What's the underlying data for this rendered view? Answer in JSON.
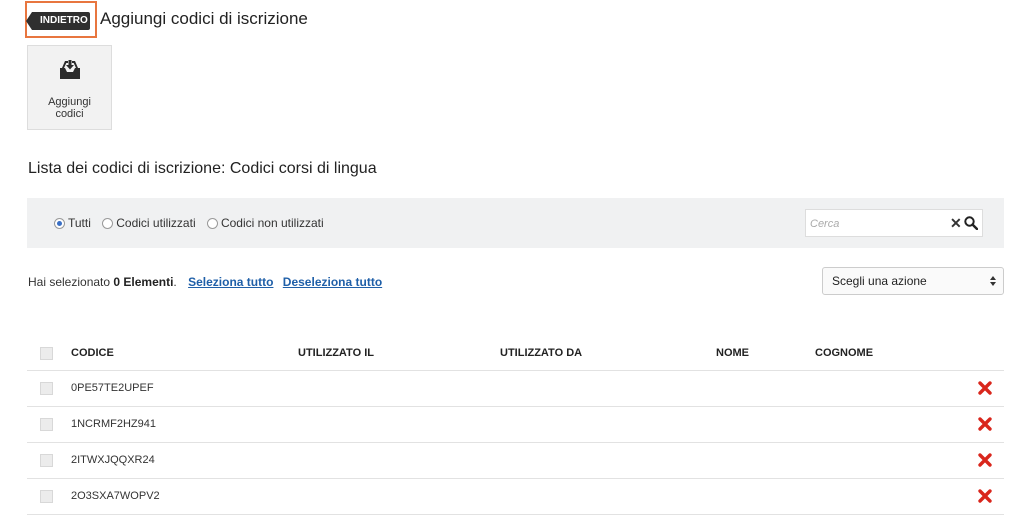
{
  "header": {
    "back_label": "INDIETRO",
    "title": "Aggiungi codici di iscrizione"
  },
  "toolbar": {
    "add_codes_label": "Aggiungi\ncodici"
  },
  "section_title": "Lista dei codici di iscrizione: Codici corsi di lingua",
  "filters": {
    "options": [
      "Tutti",
      "Codici utilizzati",
      "Codici non utilizzati"
    ],
    "selected": "Tutti",
    "search_placeholder": "Cerca",
    "search_value": ""
  },
  "selection": {
    "prefix": "Hai selezionato ",
    "count": "0 Elementi",
    "suffix": ".",
    "select_all": "Seleziona tutto",
    "deselect_all": "Deseleziona tutto"
  },
  "action_select": {
    "value": "Scegli una azione"
  },
  "table": {
    "columns": [
      "CODICE",
      "UTILIZZATO IL",
      "UTILIZZATO DA",
      "NOME",
      "COGNOME"
    ],
    "rows": [
      {
        "code": "0PE57TE2UPEF",
        "used_on": "",
        "used_by": "",
        "first_name": "",
        "last_name": ""
      },
      {
        "code": "1NCRMF2HZ941",
        "used_on": "",
        "used_by": "",
        "first_name": "",
        "last_name": ""
      },
      {
        "code": "2ITWXJQQXR24",
        "used_on": "",
        "used_by": "",
        "first_name": "",
        "last_name": ""
      },
      {
        "code": "2O3SXA7WOPV2",
        "used_on": "",
        "used_by": "",
        "first_name": "",
        "last_name": ""
      }
    ]
  },
  "colors": {
    "accent_outline": "#e8763f",
    "link": "#1f5fa8",
    "delete": "#d9261c",
    "filter_bar": "#f0f1f2"
  },
  "icons": {
    "back": "chevron-tag-icon",
    "add_codes": "inbox-download-icon",
    "search": "search-icon",
    "clear": "close-icon",
    "delete": "delete-x-icon"
  }
}
